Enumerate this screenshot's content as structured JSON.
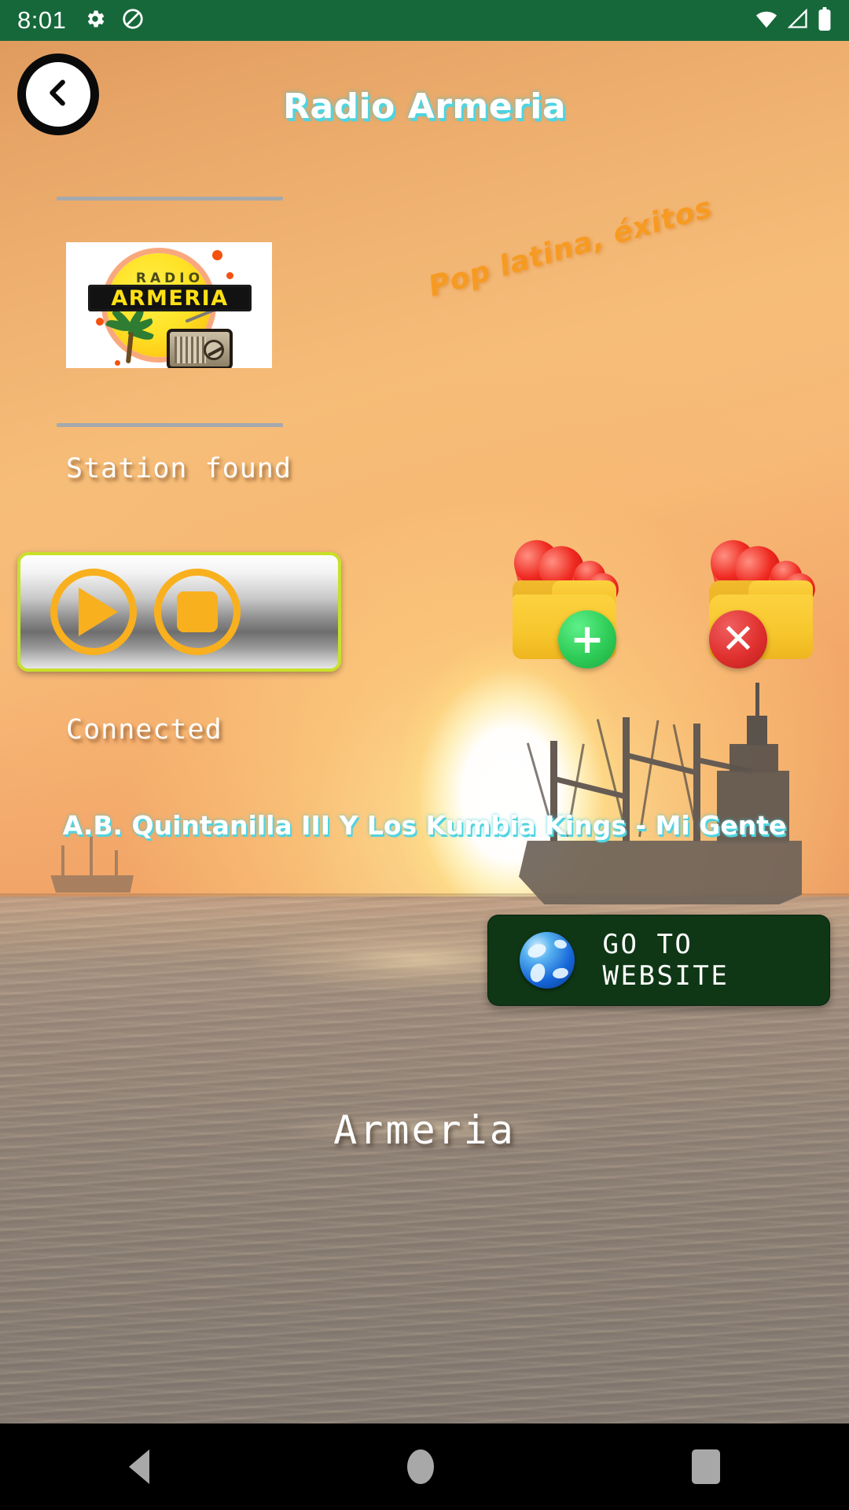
{
  "status_bar": {
    "time": "8:01",
    "icons": [
      "gear-icon",
      "do-not-disturb-icon"
    ],
    "right_icons": [
      "wifi-icon",
      "cellular-signal-icon",
      "battery-icon"
    ],
    "background_color": "#16683a"
  },
  "app_bar": {
    "back_icon": "chevron-left-icon",
    "title": "Radio Armeria",
    "title_color": "#ffffff",
    "title_shadow_color": "#4fd4e0"
  },
  "station": {
    "logo_word_top": "RADIO",
    "logo_word_main": "ARMERIA",
    "tagline": "Pop latina, éxitos",
    "tagline_color": "#f79a22",
    "found_status": "Station found",
    "connection_status": "Connected",
    "name": "Armeria"
  },
  "player": {
    "play_button_label": "play-button",
    "stop_button_label": "stop-button",
    "accent_color": "#f9b01e",
    "border_color": "#c8e02a"
  },
  "favorites": {
    "add_label": "add-to-favorites",
    "remove_label": "remove-from-favorites",
    "add_badge": "+",
    "remove_badge": "✕",
    "add_badge_color": "#2ecc56",
    "remove_badge_color": "#e0312f"
  },
  "now_playing": {
    "track": "A.B. Quintanilla III Y Los Kumbia Kings - Mi Gente"
  },
  "website_button": {
    "label": "GO TO WEBSITE",
    "icon": "globe-icon",
    "background_color": "#0f3716"
  },
  "nav_bar": {
    "back": "nav-back-icon",
    "home": "nav-home-icon",
    "recents": "nav-recents-icon"
  }
}
